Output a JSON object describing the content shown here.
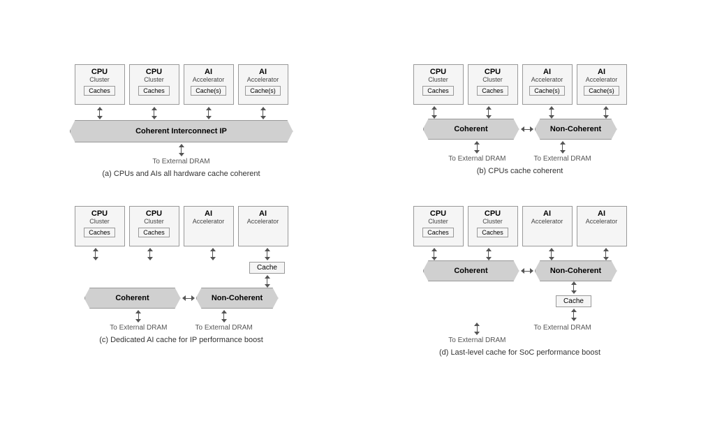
{
  "diagrams": [
    {
      "id": "a",
      "caption": "(a) CPUs and AIs all hardware cache coherent",
      "nodes": [
        {
          "title": "CPU",
          "sub": "Cluster",
          "cache": "Caches"
        },
        {
          "title": "CPU",
          "sub": "Cluster",
          "cache": "Caches"
        },
        {
          "title": "AI",
          "sub": "Accelerator",
          "cache": "Cache(s)"
        },
        {
          "title": "AI",
          "sub": "Accelerator",
          "cache": "Cache(s)"
        }
      ],
      "banner_type": "single",
      "banner_text": "Coherent Interconnect IP",
      "dram": [
        "To External DRAM"
      ]
    },
    {
      "id": "b",
      "caption": "(b) CPUs cache coherent",
      "nodes": [
        {
          "title": "CPU",
          "sub": "Cluster",
          "cache": "Caches"
        },
        {
          "title": "CPU",
          "sub": "Cluster",
          "cache": "Caches"
        },
        {
          "title": "AI",
          "sub": "Accelerator",
          "cache": "Cache(s)"
        },
        {
          "title": "AI",
          "sub": "Accelerator",
          "cache": "Cache(s)"
        }
      ],
      "banner_type": "double",
      "banner_left": "Coherent",
      "banner_right": "Non-Coherent",
      "dram": [
        "To External DRAM",
        "To External DRAM"
      ]
    },
    {
      "id": "c",
      "caption": "(c) Dedicated AI cache for IP performance boost",
      "nodes": [
        {
          "title": "CPU",
          "sub": "Cluster",
          "cache": "Caches"
        },
        {
          "title": "CPU",
          "sub": "Cluster",
          "cache": "Caches"
        },
        {
          "title": "AI",
          "sub": "Accelerator",
          "cache": null
        },
        {
          "title": "AI",
          "sub": "Accelerator",
          "cache": null
        }
      ],
      "ai_extra_cache": "Cache",
      "banner_type": "double",
      "banner_left": "Coherent",
      "banner_right": "Non-Coherent",
      "dram": [
        "To External DRAM",
        "To External DRAM"
      ]
    },
    {
      "id": "d",
      "caption": "(d) Last-level cache for SoC performance boost",
      "nodes": [
        {
          "title": "CPU",
          "sub": "Cluster",
          "cache": "Caches"
        },
        {
          "title": "CPU",
          "sub": "Cluster",
          "cache": "Caches"
        },
        {
          "title": "AI",
          "sub": "Accelerator",
          "cache": null
        },
        {
          "title": "AI",
          "sub": "Accelerator",
          "cache": null
        }
      ],
      "ai_extra_cache": null,
      "banner_type": "double_with_bottom_cache",
      "banner_left": "Coherent",
      "banner_right": "Non-Coherent",
      "bottom_cache": "Cache",
      "dram": [
        "To External DRAM",
        "To External DRAM"
      ]
    }
  ],
  "colors": {
    "box_bg": "#f5f5f5",
    "box_border": "#999",
    "banner_bg": "#d0d0d0",
    "text": "#333",
    "arrow": "#555"
  }
}
